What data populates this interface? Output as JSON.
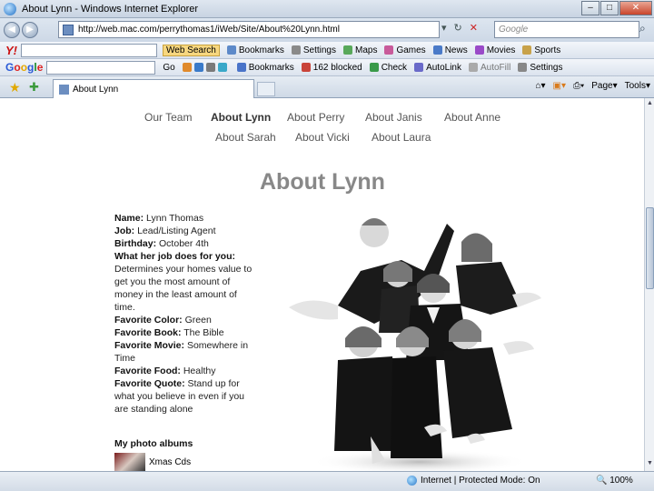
{
  "window": {
    "title": "About Lynn - Windows Internet Explorer"
  },
  "address_bar": {
    "url": "http://web.mac.com/perrythomas1/iWeb/Site/About%20Lynn.html",
    "search_placeholder": "Google"
  },
  "yahoo_toolbar": {
    "logo": "Y!",
    "web_search": "Web Search",
    "items": [
      "Bookmarks",
      "Settings",
      "Maps",
      "Games",
      "News",
      "Movies",
      "Sports"
    ]
  },
  "google_toolbar": {
    "logo": "Google",
    "go_label": "Go",
    "bookmarks": "Bookmarks",
    "blocked": "162 blocked",
    "check": "Check",
    "autolink": "AutoLink",
    "autofill": "AutoFill",
    "settings": "Settings"
  },
  "tab": {
    "label": "About Lynn"
  },
  "command_bar": {
    "page": "Page",
    "tools": "Tools"
  },
  "site_nav": [
    {
      "label": "Our Team"
    },
    {
      "label": "About Lynn"
    },
    {
      "label": "About Perry"
    },
    {
      "label": "About Janis"
    },
    {
      "label": "About Anne"
    },
    {
      "label": "About Sarah"
    },
    {
      "label": "About Vicki"
    },
    {
      "label": "About Laura"
    }
  ],
  "page": {
    "heading": "About Lynn",
    "bio": {
      "name_label": "Name:",
      "name": "Lynn Thomas",
      "job_label": "Job:",
      "job": "Lead/Listing Agent",
      "birthday_label": "Birthday:",
      "birthday": "October 4th",
      "job_does_label": "What her job does for you:",
      "job_does": "Determines your homes value to get you the most amount of money in the least amount of time.",
      "color_label": "Favorite Color:",
      "color": "Green",
      "book_label": "Favorite Book:",
      "book": "The Bible",
      "movie_label": "Favorite Movie:",
      "movie": "Somewhere in Time",
      "food_label": "Favorite Food:",
      "food": "Healthy",
      "quote_label": "Favorite Quote:",
      "quote": "Stand up for what you believe in even if you are standing alone"
    },
    "albums_heading": "My photo albums",
    "albums": [
      {
        "label": "Xmas Cds"
      }
    ]
  },
  "status_bar": {
    "zone": "Internet | Protected Mode: On",
    "zoom": "100%"
  },
  "colors": {
    "heading": "#888888",
    "nav_text": "#555555",
    "chrome": "#cdd8e6"
  }
}
